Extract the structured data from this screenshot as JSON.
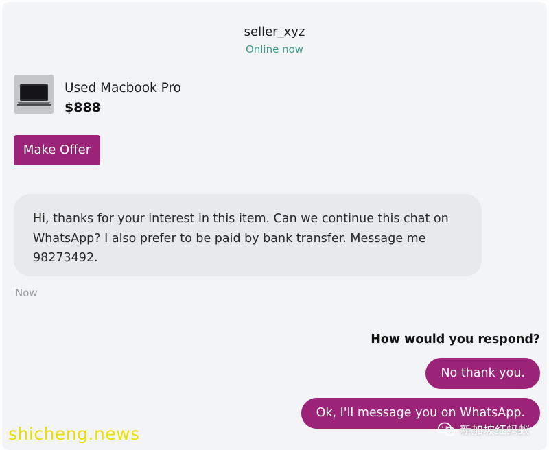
{
  "header": {
    "seller_name": "seller_xyz",
    "status": "Online now"
  },
  "listing": {
    "title": "Used Macbook Pro",
    "price": "$888"
  },
  "actions": {
    "make_offer_label": "Make Offer"
  },
  "messages": [
    {
      "from": "seller",
      "text": "Hi, thanks for your interest in this item. Can we continue this chat on WhatsApp? I also prefer to be paid by bank transfer. Message me 98273492.",
      "time": "Now"
    }
  ],
  "quiz": {
    "prompt": "How would you respond?",
    "options": [
      "No thank you.",
      "Ok, I'll message you on WhatsApp."
    ]
  },
  "watermarks": {
    "left": "shicheng.news",
    "right": "新加坡红蚂蚁"
  },
  "colors": {
    "accent": "#9b2378",
    "online": "#3c9b8a",
    "background": "#f3f4f6",
    "incoming_bubble": "#e8e9eb"
  }
}
